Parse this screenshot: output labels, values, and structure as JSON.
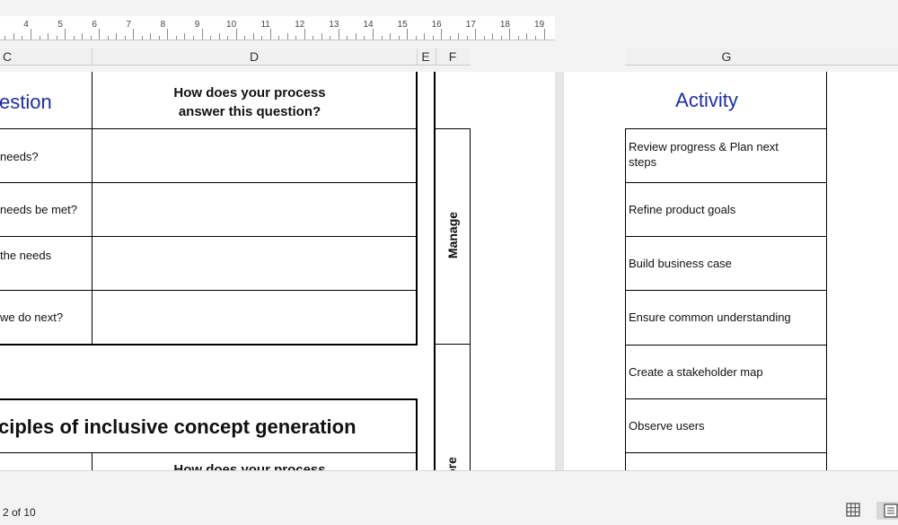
{
  "ruler": {
    "numbers": [
      "4",
      "5",
      "6",
      "7",
      "8",
      "9",
      "10",
      "11",
      "12",
      "13",
      "14",
      "15",
      "16",
      "17",
      "18",
      "19"
    ]
  },
  "columns": {
    "left": [
      "C",
      "D",
      "E",
      "F"
    ],
    "right": [
      "G"
    ]
  },
  "left_page": {
    "header_question": "estion",
    "header_process_line1": "How does your process",
    "header_process_line2": "answer this question?",
    "questions": [
      "needs?",
      "needs be met?",
      "the needs",
      "we do next?"
    ],
    "section_title": "ciples of inclusive concept generation",
    "partial_header": "How does your process"
  },
  "band": {
    "manage": "Manage",
    "partial": "ore"
  },
  "right_page": {
    "activity_header": "Activity",
    "activities": [
      "Review progress & Plan next steps",
      "Refine product goals",
      "Build business case",
      "Ensure common understanding",
      "Create a stakeholder map",
      "Observe users"
    ]
  },
  "statusbar": {
    "page_indicator": "2 of 10"
  },
  "icons": {
    "normal_view": "grid-icon",
    "page_layout_view": "page-layout-icon"
  },
  "colors": {
    "header_blue": "#1b2fa8",
    "workspace": "#e6e6e6"
  }
}
